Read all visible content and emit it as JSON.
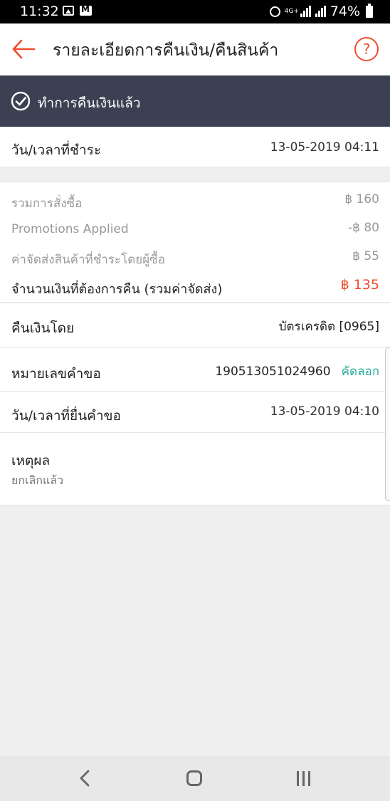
{
  "status_bar": {
    "time": "11:32",
    "network": "4G+",
    "battery": "74%"
  },
  "header": {
    "title": "รายละเอียดการคืนเงิน/คืนสินค้า"
  },
  "status_banner": {
    "text": "ทำการคืนเงินแล้ว"
  },
  "payment_time": {
    "label": "วัน/เวลาที่ชำระ",
    "value": "13-05-2019 04:11"
  },
  "summary": {
    "order_total_label": "รวมการสั่งซื้อ",
    "order_total_value": "฿ 160",
    "promotions_label": "Promotions Applied",
    "promotions_value": "-฿ 80",
    "shipping_label": "ค่าจัดส่งสินค้าที่ชำระโดยผู้ซื้อ",
    "shipping_value": "฿ 55",
    "refund_label": "จำนวนเงินที่ต้องการคืน (รวมค่าจัดส่ง)",
    "refund_value": "฿ 135"
  },
  "refund_method": {
    "label": "คืนเงินโดย",
    "value": "บัตรเครดิต [0965]"
  },
  "request_no": {
    "label": "หมายเลขคำขอ",
    "value": "190513051024960",
    "copy": "คัดลอก"
  },
  "request_time": {
    "label": "วัน/เวลาที่ยื่นคำขอ",
    "value": "13-05-2019 04:10"
  },
  "reason": {
    "label": "เหตุผล",
    "value": "ยกเลิกแล้ว"
  },
  "colors": {
    "accent": "#ee4d2d",
    "banner": "#3b4152",
    "link": "#26aa99"
  }
}
